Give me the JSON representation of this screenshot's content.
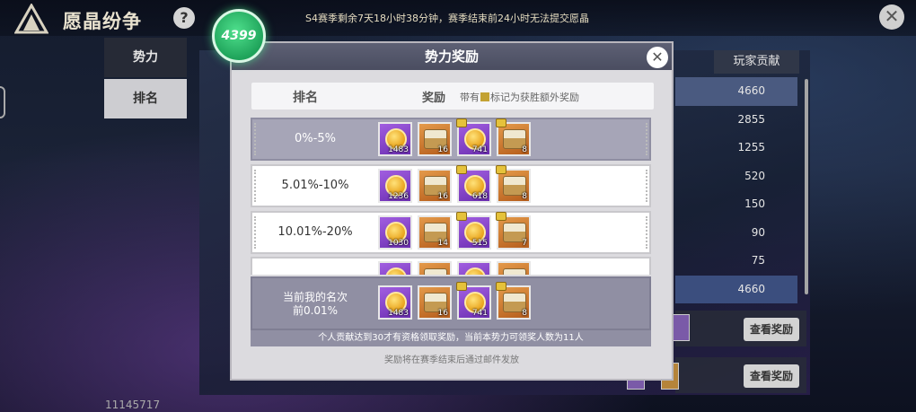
{
  "header": {
    "title": "愿晶纷争",
    "help_label": "?",
    "season_info": "S4赛季剩余7天18小时38分钟，赛季结束前24小时无法提交愿晶",
    "close_label": "✕"
  },
  "points_badge": "4399",
  "side_tabs": [
    {
      "label": "势力"
    },
    {
      "label": "排名"
    }
  ],
  "user_id": "11145717",
  "background_list": {
    "header": "玩家贡献",
    "values": [
      "4660",
      "2855",
      "1255",
      "520",
      "150",
      "90",
      "75",
      "4660"
    ],
    "view_reward_label": "查看奖励"
  },
  "modal": {
    "title": "势力奖励",
    "close_label": "✕",
    "col_rank": "排名",
    "col_reward": "奖励",
    "note_prefix": "带有",
    "note_suffix": "标记为获胜额外奖励",
    "tiers": [
      {
        "label": "0%-5%",
        "items": [
          {
            "type": "coin",
            "bg": "purple",
            "count": "1483",
            "bonus": false
          },
          {
            "type": "chest",
            "bg": "orange",
            "count": "16",
            "bonus": false
          },
          {
            "type": "coin",
            "bg": "purple",
            "count": "741",
            "bonus": true
          },
          {
            "type": "chest",
            "bg": "orange",
            "count": "8",
            "bonus": true
          }
        ]
      },
      {
        "label": "5.01%-10%",
        "items": [
          {
            "type": "coin",
            "bg": "purple",
            "count": "1236",
            "bonus": false
          },
          {
            "type": "chest",
            "bg": "orange",
            "count": "16",
            "bonus": false
          },
          {
            "type": "coin",
            "bg": "purple",
            "count": "618",
            "bonus": true
          },
          {
            "type": "chest",
            "bg": "orange",
            "count": "8",
            "bonus": true
          }
        ]
      },
      {
        "label": "10.01%-20%",
        "items": [
          {
            "type": "coin",
            "bg": "purple",
            "count": "1030",
            "bonus": false
          },
          {
            "type": "chest",
            "bg": "orange",
            "count": "14",
            "bonus": false
          },
          {
            "type": "coin",
            "bg": "purple",
            "count": "515",
            "bonus": true
          },
          {
            "type": "chest",
            "bg": "orange",
            "count": "7",
            "bonus": true
          }
        ]
      }
    ],
    "my_rank": {
      "label_line1": "当前我的名次",
      "label_line2": "前0.01%",
      "items": [
        {
          "type": "coin",
          "bg": "purple",
          "count": "1483",
          "bonus": false
        },
        {
          "type": "chest",
          "bg": "orange",
          "count": "16",
          "bonus": false
        },
        {
          "type": "coin",
          "bg": "purple",
          "count": "741",
          "bonus": true
        },
        {
          "type": "chest",
          "bg": "orange",
          "count": "8",
          "bonus": true
        }
      ],
      "note": "个人贡献达到30才有资格领取奖励，当前本势力可领奖人数为11人"
    },
    "footer": "奖励将在赛季结束后通过邮件发放"
  }
}
